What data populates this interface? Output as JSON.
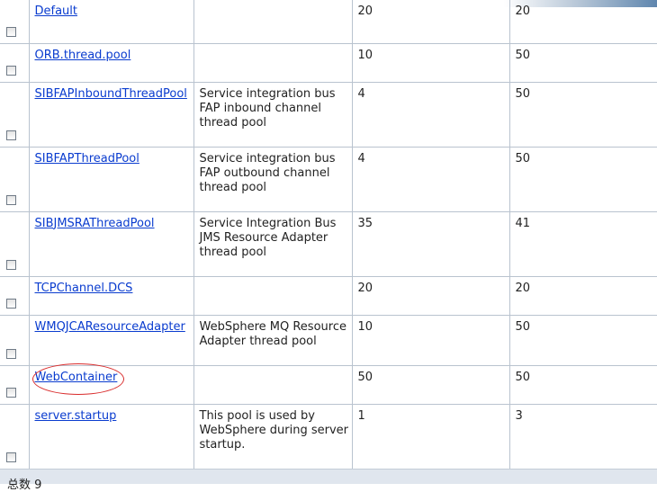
{
  "table": {
    "rows": [
      {
        "name": "Default",
        "description": "",
        "min": "20",
        "max": "20"
      },
      {
        "name": "ORB.thread.pool",
        "description": "",
        "min": "10",
        "max": "50"
      },
      {
        "name": "SIBFAPInboundThreadPool",
        "description": "Service integration bus FAP inbound channel thread pool",
        "min": "4",
        "max": "50"
      },
      {
        "name": "SIBFAPThreadPool",
        "description": "Service integration bus FAP outbound channel thread pool",
        "min": "4",
        "max": "50"
      },
      {
        "name": "SIBJMSRAThreadPool",
        "description": "Service Integration Bus JMS Resource Adapter thread pool",
        "min": "35",
        "max": "41"
      },
      {
        "name": "TCPChannel.DCS",
        "description": "",
        "min": "20",
        "max": "20"
      },
      {
        "name": "WMQJCAResourceAdapter",
        "description": "WebSphere MQ Resource Adapter thread pool",
        "min": "10",
        "max": "50"
      },
      {
        "name": "WebContainer",
        "description": "",
        "min": "50",
        "max": "50"
      },
      {
        "name": "server.startup",
        "description": "This pool is used by WebSphere during server startup.",
        "min": "1",
        "max": "3"
      }
    ]
  },
  "footer": {
    "total_text": "总数 9"
  },
  "annotation": {
    "highlight_color": "#d92b2b"
  }
}
